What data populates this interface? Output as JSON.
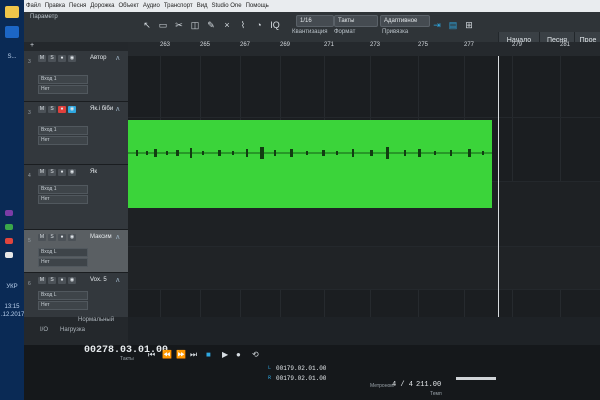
{
  "taskbar": {
    "items": [
      "S...",
      "УКР",
      "13:15",
      ".12.2017"
    ]
  },
  "menubar": {
    "items": [
      "Файл",
      "Правка",
      "Песня",
      "Дорожка",
      "Объект",
      "Аудио",
      "Транспорт",
      "Вид",
      "Studio One",
      "Помощь"
    ],
    "param_label": "Параметр"
  },
  "toolbar": {
    "quant_value": "1/16",
    "quant_label": "Квантизация",
    "format_value": "Такты",
    "format_label": "Формат",
    "snap_value": "Адаптивное",
    "snap_label": "Привязка",
    "start_button": "Начало",
    "song_button": "Песня",
    "project_button": "Прое"
  },
  "ruler": {
    "ticks": [
      "263",
      "265",
      "267",
      "269",
      "271",
      "273",
      "275",
      "277",
      "279",
      "281"
    ]
  },
  "tracks": [
    {
      "num": "3",
      "name": "Автор",
      "input": "Вход 1",
      "output": "Нет",
      "rec": false
    },
    {
      "num": "3",
      "name": "Як.і біби",
      "input": "Вход 1",
      "output": "Нет",
      "rec": true
    },
    {
      "num": "4",
      "name": "Як",
      "input": "Вход 1",
      "output": "Нет",
      "rec": false
    },
    {
      "num": "5",
      "name": "Максим",
      "input": "Вход L",
      "output": "Нет",
      "rec": false
    },
    {
      "num": "6",
      "name": "Vox. 5",
      "input": "Вход L",
      "output": "Нет",
      "rec": false
    }
  ],
  "bottom_tabs": {
    "tab1": "I/O",
    "tab2": "Нагрузка",
    "mode": "Нормальный"
  },
  "transport": {
    "position": "00278.03.01.00",
    "position_unit": "Такты",
    "loop_left": "00179.02.01.00",
    "loop_right": "00179.02.01.00",
    "metronome": "Метроном",
    "signature": "4 / 4",
    "tempo": "211.00",
    "tempo_label": "Темп"
  },
  "colors": {
    "clip": "#3bd43a",
    "rec": "#e0403c",
    "accent": "#2ea7e0"
  }
}
